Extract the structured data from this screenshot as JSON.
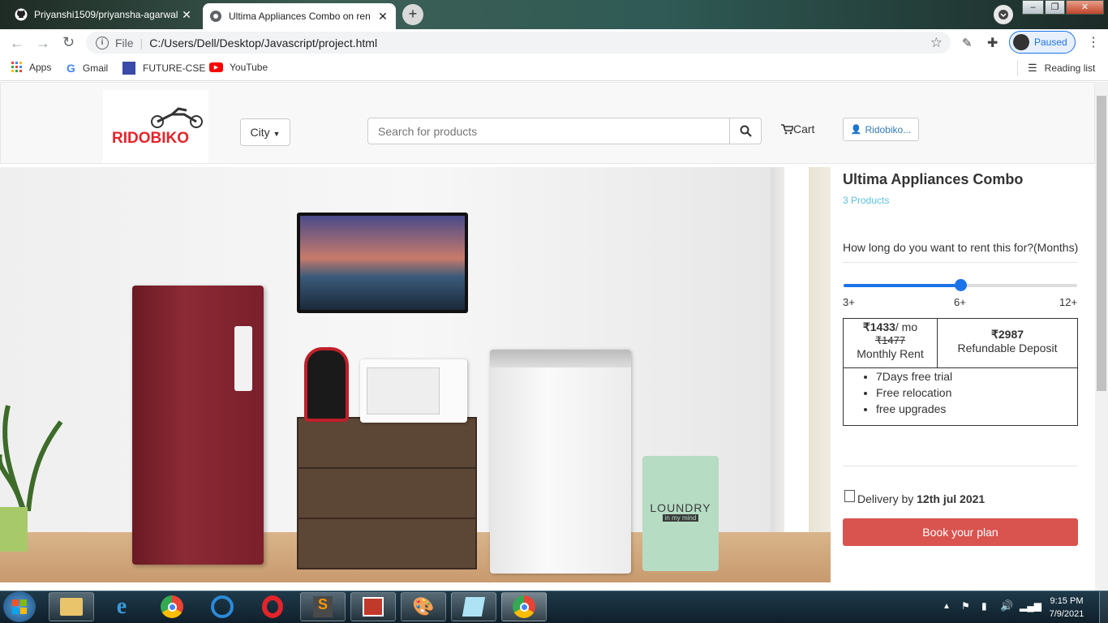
{
  "browser": {
    "tabs": [
      {
        "title": "Priyanshi1509/priyansha-agarwal",
        "close": "✕"
      },
      {
        "title": "Ultima Appliances Combo on ren",
        "close": "✕"
      }
    ],
    "new_tab": "+",
    "address_prefix": "File",
    "address": "C:/Users/Dell/Desktop/Javascript/project.html",
    "profile_status": "Paused",
    "bookmarks": [
      "Apps",
      "Gmail",
      "FUTURE-CSE",
      "YouTube"
    ],
    "reading_list": "Reading list"
  },
  "navbar": {
    "logo_text": "RIDOBIKO",
    "city": "City",
    "search_placeholder": "Search for products",
    "cart": "Cart",
    "user": "Ridobiko..."
  },
  "product": {
    "title": "Ultima Appliances Combo",
    "count": "3 Products",
    "question": "How long do you want to rent this for?(Months)",
    "slider": {
      "ticks": [
        "3+",
        "6+",
        "12+"
      ],
      "value_fraction": 0.5
    },
    "price": "₹1433",
    "price_unit": "/ mo",
    "old_price": "₹1477",
    "rent_label": "Monthly Rent",
    "deposit": "₹2987",
    "deposit_label": "Refundable Deposit",
    "features": [
      "7Days free trial",
      "Free relocation",
      "free upgrades"
    ],
    "delivery_prefix": "Delivery by",
    "delivery_date": "12th jul 2021",
    "book_button": "Book your plan"
  },
  "hero": {
    "basket_text": "LOUNDRY",
    "basket_sub": "in my mind"
  },
  "taskbar": {
    "time": "9:15 PM",
    "date": "7/9/2021"
  },
  "colors": {
    "accent": "#d9534f",
    "slider": "#1a73e8",
    "link": "#5bc0de"
  }
}
